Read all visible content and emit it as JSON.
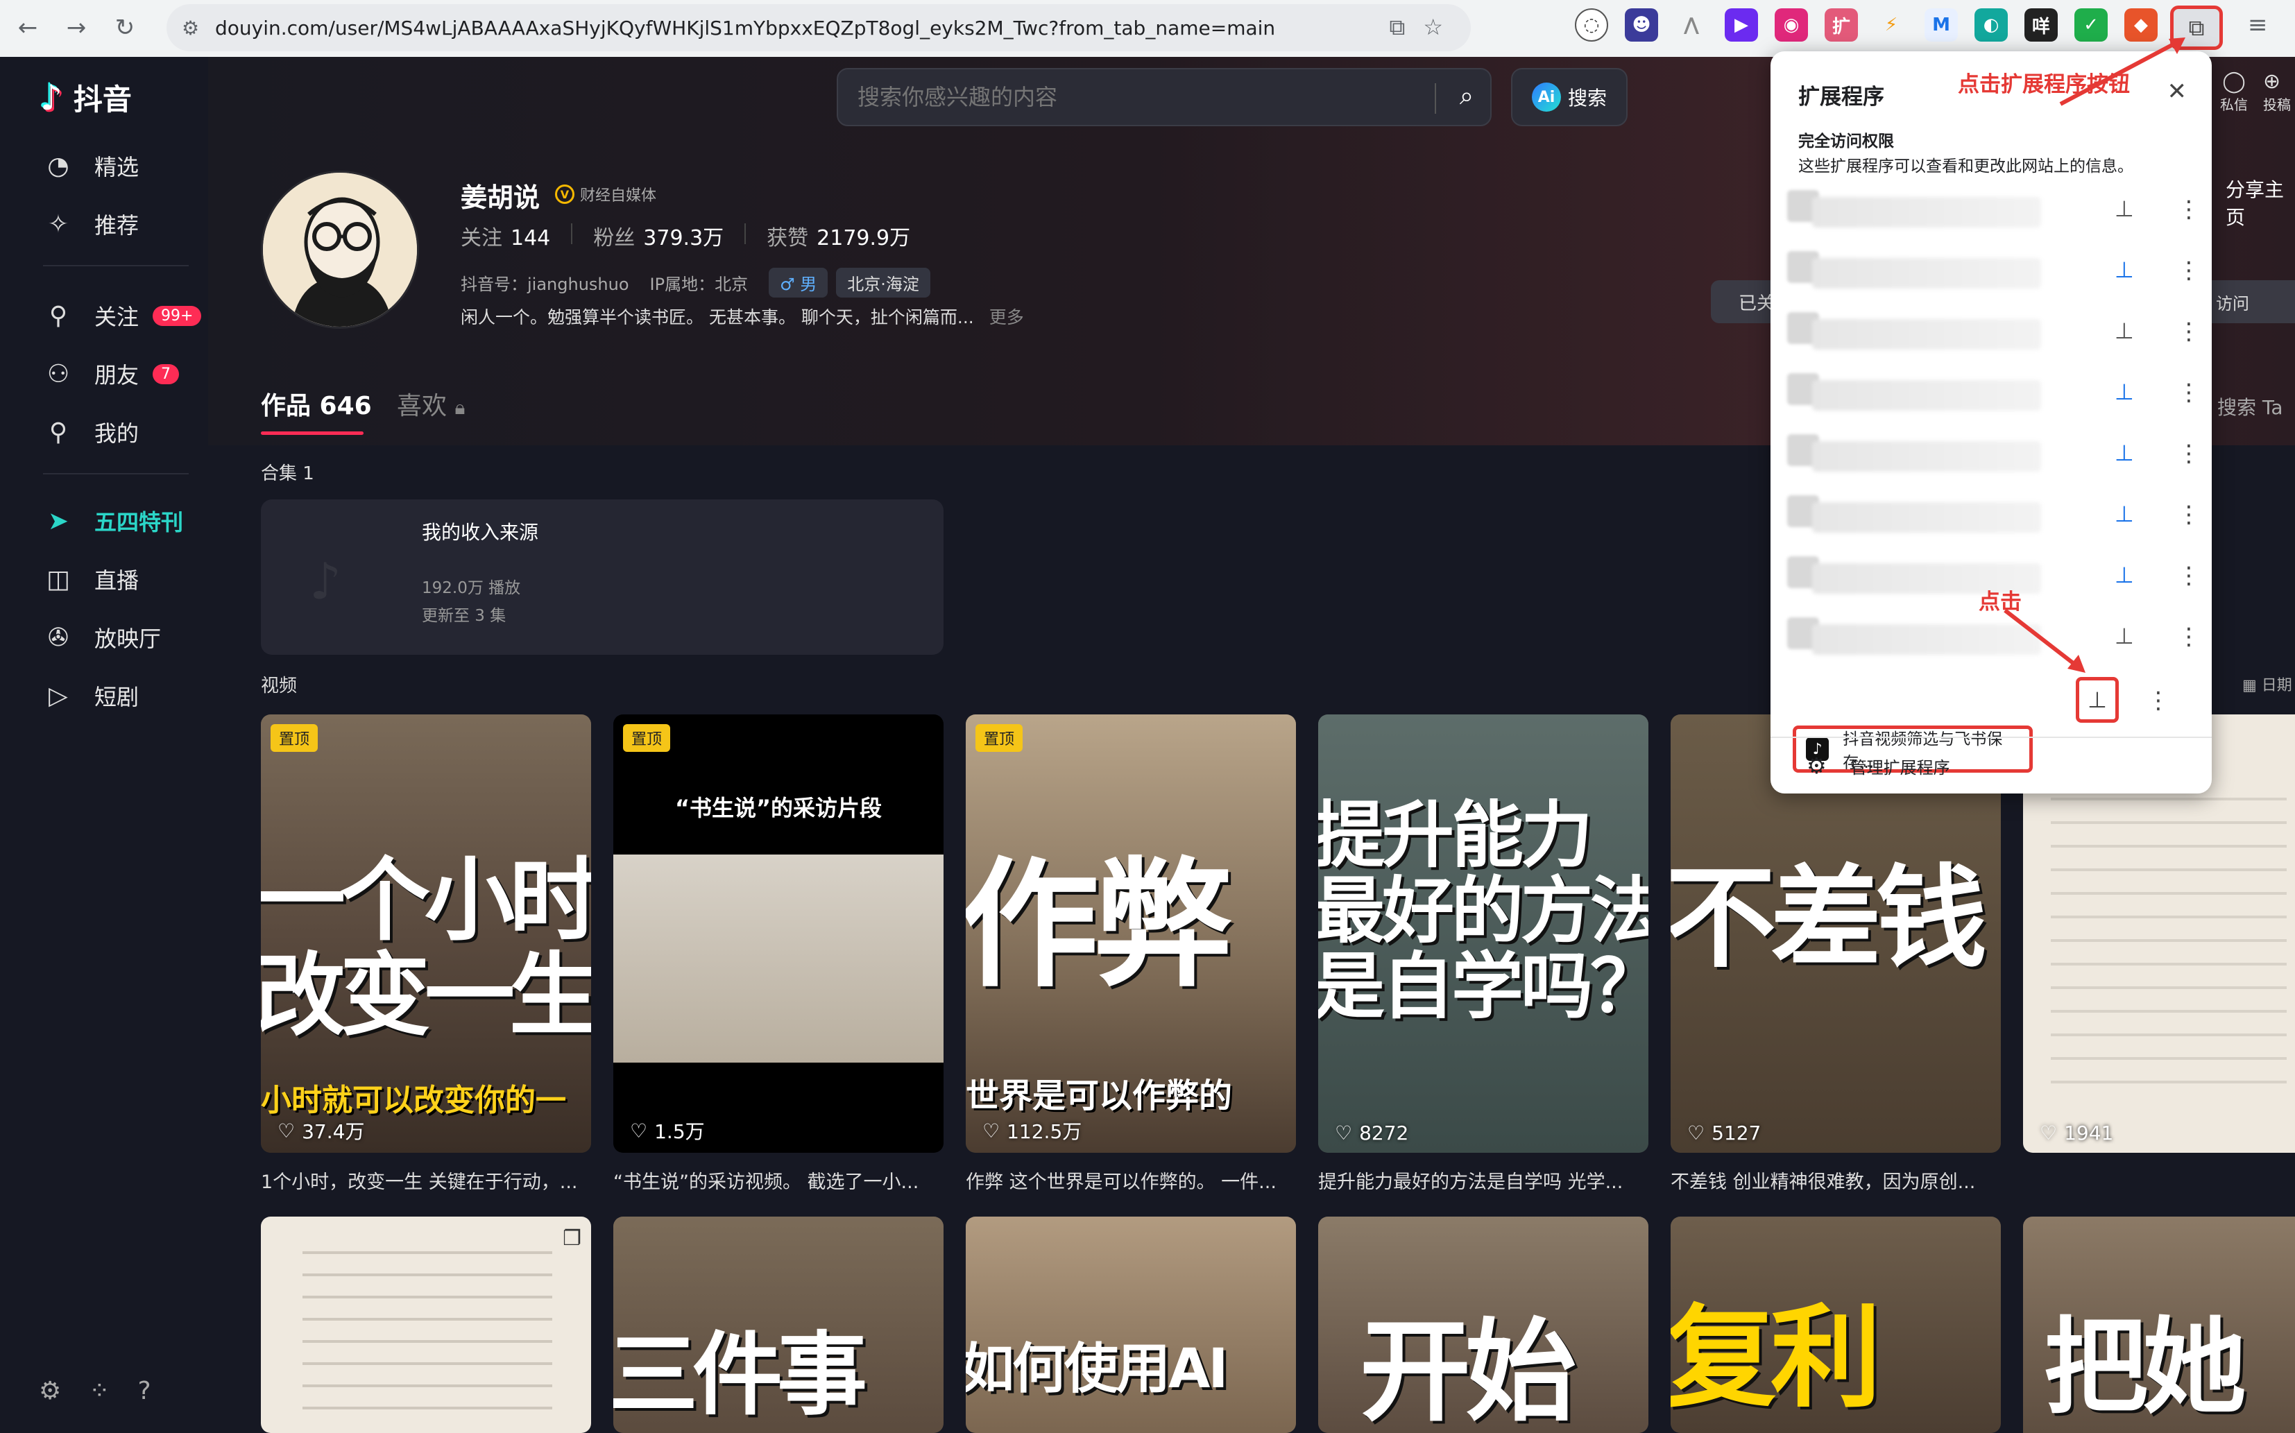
{
  "browser": {
    "url": "douyin.com/user/MS4wLjABAAAAxaSHyjKQyfWHKjlS1mYbpxxEQZpT8ogl_eyks2M_Twc?from_tab_name=main"
  },
  "sidebar": {
    "logo": "抖音",
    "items": [
      {
        "label": "精选"
      },
      {
        "label": "推荐"
      },
      {
        "label": "关注",
        "badge": "99+"
      },
      {
        "label": "朋友",
        "badge": "7"
      },
      {
        "label": "我的"
      },
      {
        "label": "五四特刊"
      },
      {
        "label": "直播"
      },
      {
        "label": "放映厅"
      },
      {
        "label": "短剧"
      }
    ]
  },
  "search": {
    "placeholder": "搜索你感兴趣的内容",
    "ai_label": "搜索"
  },
  "right_cut": {
    "msg": "私信",
    "post": "投稿",
    "share": "分享主页",
    "followed": "已关",
    "visit": "访问",
    "search": "搜索 Ta",
    "date": "日期"
  },
  "profile": {
    "name": "姜胡说",
    "verified": "财经自媒体",
    "following_label": "关注",
    "following": "144",
    "fans_label": "粉丝",
    "fans": "379.3万",
    "likes_label": "获赞",
    "likes": "2179.9万",
    "douyin_id": "抖音号：jianghushuo",
    "ip": "IP属地：北京",
    "gender": "♂ 男",
    "location": "北京·海淀",
    "bio": "闲人一个。勉强算半个读书匠。 无甚本事。 聊个天，扯个闲篇而...",
    "more": "更多"
  },
  "tabs": {
    "works": "作品 646",
    "likes": "喜欢"
  },
  "collection": {
    "section": "合集 1",
    "title": "我的收入来源",
    "plays": "192.0万 播放",
    "updated": "更新至 3 集"
  },
  "videos_section": "视频",
  "videos": [
    {
      "pin": "置顶",
      "big": "一个小时\n改变一生",
      "sub": "小时就可以改变你的一",
      "likes": "37.4万",
      "caption": "1个小时，改变一生 关键在于行动，..."
    },
    {
      "pin": "置顶",
      "big": "",
      "sub": "“书生说”的采访片段",
      "likes": "1.5万",
      "caption": "“书生说”的采访视频。 截选了一小..."
    },
    {
      "pin": "置顶",
      "big": "作弊",
      "sub": "世界是可以作弊的",
      "likes": "112.5万",
      "caption": "作弊 这个世界是可以作弊的。 一件..."
    },
    {
      "pin": "",
      "big": "提升能力\n最好的方法\n是自学吗？",
      "sub": "",
      "likes": "8272",
      "caption": "提升能力最好的方法是自学吗 光学..."
    },
    {
      "pin": "",
      "big": "不差钱",
      "sub": "",
      "likes": "5127",
      "caption": "不差钱 创业精神很难教，因为原创..."
    },
    {
      "pin": "",
      "big": "",
      "sub": "",
      "likes": "1941",
      "caption": ""
    }
  ],
  "videos_row2": [
    {
      "big": ""
    },
    {
      "big": "三件事"
    },
    {
      "big": "如何使用AI"
    },
    {
      "big": "开始"
    },
    {
      "big": "复利"
    },
    {
      "big": "把她"
    }
  ],
  "extensions": {
    "title": "扩展程序",
    "section": "完全访问权限",
    "desc": "这些扩展程序可以查看和更改此网站上的信息。",
    "target_name": "抖音视频筛选与飞书保存...",
    "manage": "管理扩展程序"
  },
  "annotations": {
    "click_ext": "点击扩展程序按钮",
    "click": "点击"
  },
  "colors": {
    "accent": "#fe2c55",
    "active_nav": "#2bd6c8",
    "annotation": "#e53935"
  }
}
